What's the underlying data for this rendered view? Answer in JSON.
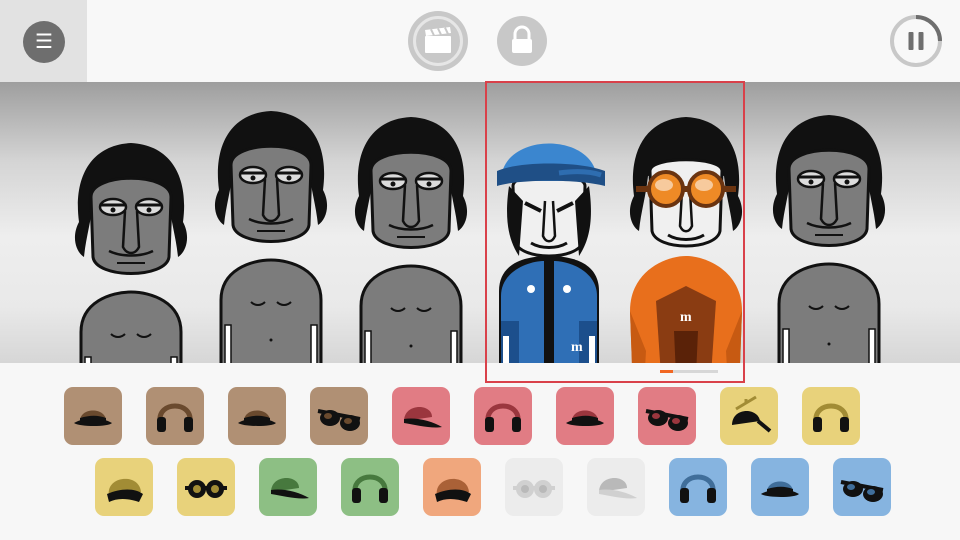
{
  "header": {
    "menu_icon": "☰",
    "menu_button": "menu-icon",
    "clapper_button": "clapperboard-icon",
    "lock_button": "lock-icon",
    "pause_button": "pause-icon"
  },
  "stage": {
    "characters": [
      {
        "slot": 1,
        "outfit": "none"
      },
      {
        "slot": 2,
        "outfit": "none"
      },
      {
        "slot": 3,
        "outfit": "none"
      },
      {
        "slot": 4,
        "outfit": "blue-cap-blue-vest"
      },
      {
        "slot": 5,
        "outfit": "orange-goggles-orange-jacket"
      },
      {
        "slot": 6,
        "outfit": "none"
      }
    ],
    "selection_progress": 0.22,
    "shirt_letter": "m"
  },
  "colors": {
    "brown": "#b09074",
    "red": "#e17c84",
    "yellow": "#e8d27b",
    "green": "#8dbf84",
    "orange": "#f0a77d",
    "white": "#ececec",
    "blue": "#86b4e0",
    "selection": "#d9414a"
  },
  "tray": {
    "row1": [
      {
        "icon": "fedora-hat-icon",
        "color": "#b09074"
      },
      {
        "icon": "headphones-icon",
        "color": "#b09074"
      },
      {
        "icon": "fedora-hat-icon",
        "color": "#b09074"
      },
      {
        "icon": "sunglasses-icon",
        "color": "#b09074"
      },
      {
        "icon": "cap-icon",
        "color": "#e17c84"
      },
      {
        "icon": "headphones-icon",
        "color": "#e17c84"
      },
      {
        "icon": "fedora-hat-icon",
        "color": "#e17c84"
      },
      {
        "icon": "sunglasses-icon",
        "color": "#e17c84"
      },
      {
        "icon": "propeller-cap-icon",
        "color": "#e8d27b"
      },
      {
        "icon": "headphones-icon",
        "color": "#e8d27b"
      }
    ],
    "row2": [
      {
        "icon": "beanie-icon",
        "color": "#e8d27b"
      },
      {
        "icon": "goggles-icon",
        "color": "#e8d27b"
      },
      {
        "icon": "cap-icon",
        "color": "#8dbf84"
      },
      {
        "icon": "headphones-icon",
        "color": "#8dbf84"
      },
      {
        "icon": "beanie-icon",
        "color": "#f0a77d"
      },
      {
        "icon": "goggles-icon",
        "color": "#ececec"
      },
      {
        "icon": "cap-icon",
        "color": "#ececec"
      },
      {
        "icon": "headphones-icon",
        "color": "#86b4e0"
      },
      {
        "icon": "fedora-hat-icon",
        "color": "#86b4e0"
      },
      {
        "icon": "sunglasses-icon",
        "color": "#86b4e0"
      }
    ]
  }
}
